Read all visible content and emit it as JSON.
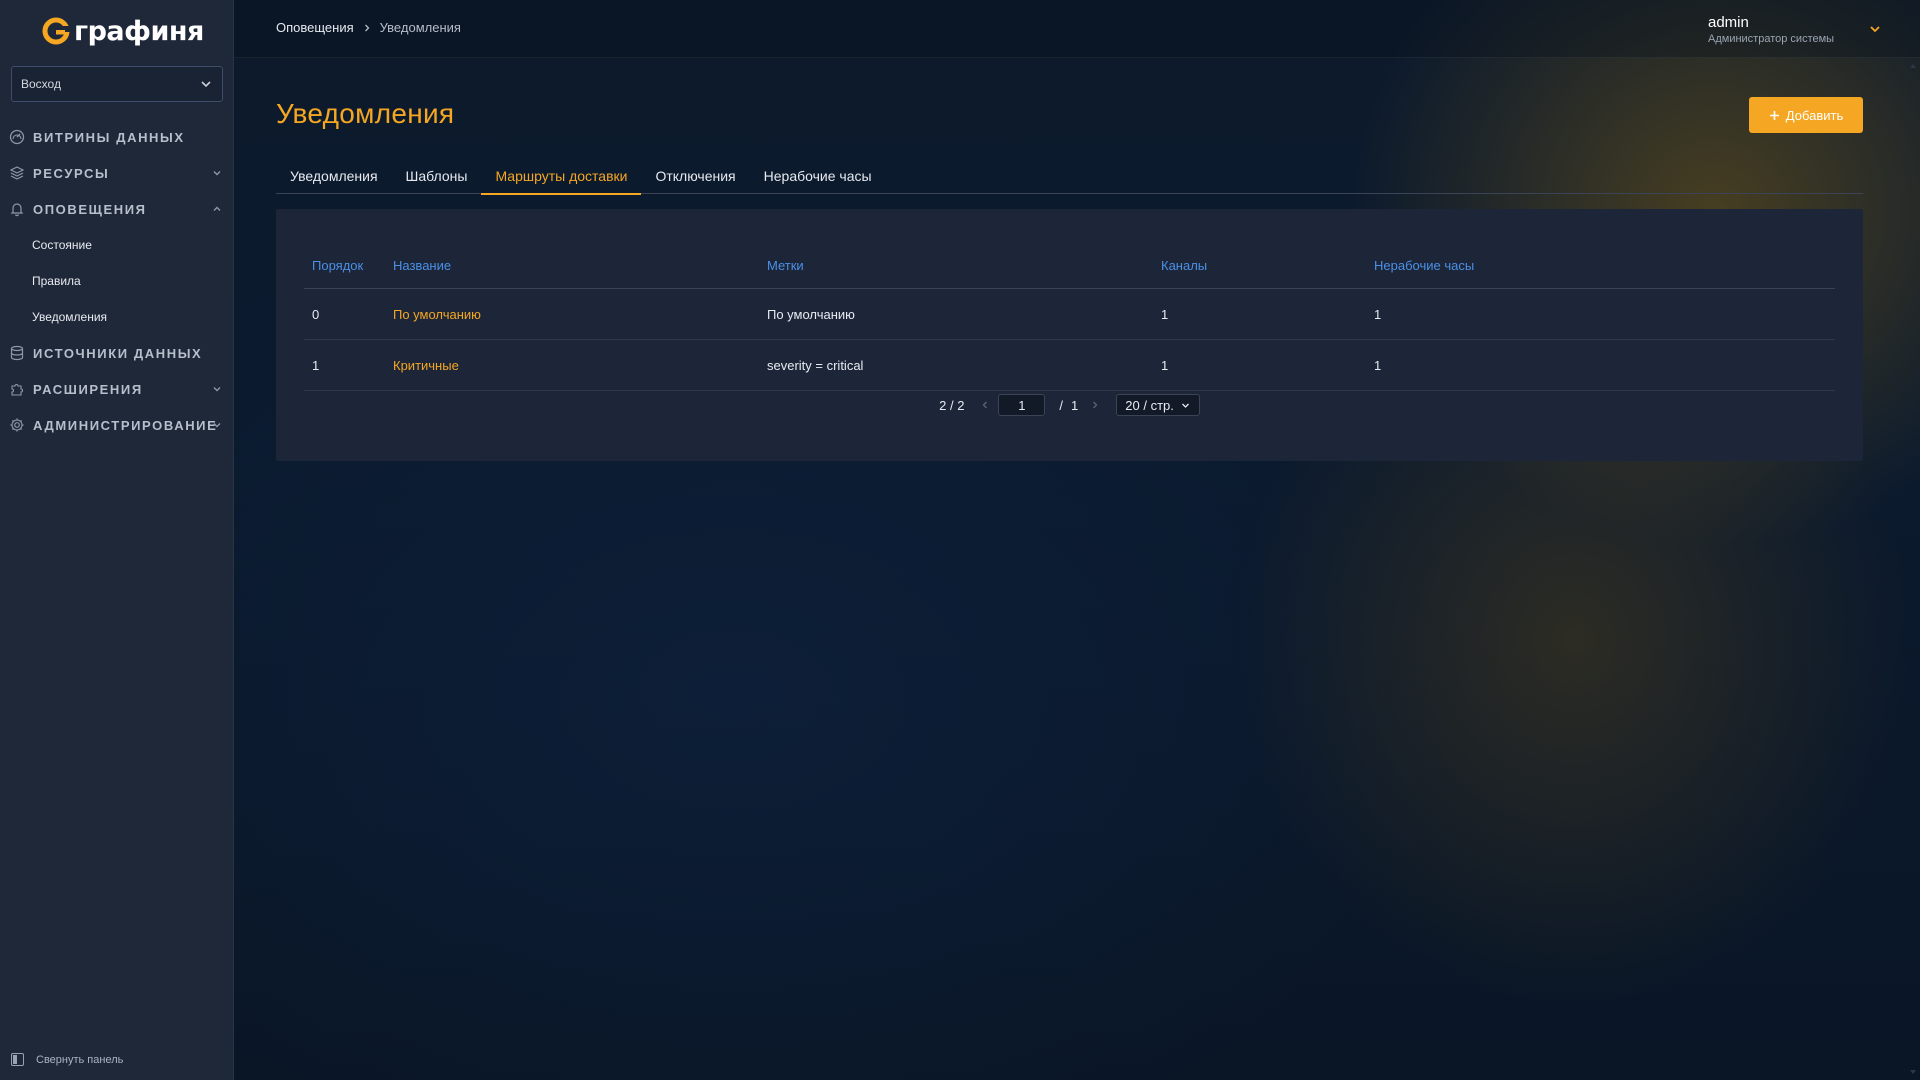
{
  "app": {
    "logo_text": "графиня",
    "org_select": "Восход",
    "collapse_label": "Свернуть панель"
  },
  "sidebar": {
    "items": [
      {
        "label": "ВИТРИНЫ ДАННЫХ",
        "icon": "gauge-icon"
      },
      {
        "label": "РЕСУРСЫ",
        "icon": "layers-icon"
      },
      {
        "label": "ОПОВЕЩЕНИЯ",
        "icon": "bell-icon"
      },
      {
        "label": "ИСТОЧНИКИ ДАННЫХ",
        "icon": "database-icon"
      },
      {
        "label": "РАСШИРЕНИЯ",
        "icon": "puzzle-icon"
      },
      {
        "label": "АДМИНИСТРИРОВАНИЕ",
        "icon": "gear-icon"
      }
    ],
    "alert_subitems": [
      "Состояние",
      "Правила",
      "Уведомления"
    ]
  },
  "header": {
    "breadcrumb": [
      "Оповещения",
      "Уведомления"
    ],
    "user_name": "admin",
    "user_role": "Администратор системы"
  },
  "page": {
    "title": "Уведомления",
    "add_button": "Добавить",
    "tabs": [
      "Уведомления",
      "Шаблоны",
      "Маршруты доставки",
      "Отключения",
      "Нерабочие часы"
    ],
    "active_tab": 2
  },
  "table": {
    "columns": [
      "Порядок",
      "Название",
      "Метки",
      "Каналы",
      "Нерабочие часы"
    ],
    "rows": [
      {
        "order": "0",
        "name": "По умолчанию",
        "labels": "По умолчанию",
        "channels": "1",
        "off_hours": "1"
      },
      {
        "order": "1",
        "name": "Критичные",
        "labels": "severity = critical",
        "channels": "1",
        "off_hours": "1"
      }
    ]
  },
  "pagination": {
    "total": "2 / 2",
    "current_page": "1",
    "slash": "/",
    "total_pages": "1",
    "page_size": "20 / стр."
  },
  "colors": {
    "accent": "#f5a623",
    "link_header": "#4b8fe6",
    "sidebar_bg": "#1f2838",
    "card_bg": "#1c2638"
  }
}
